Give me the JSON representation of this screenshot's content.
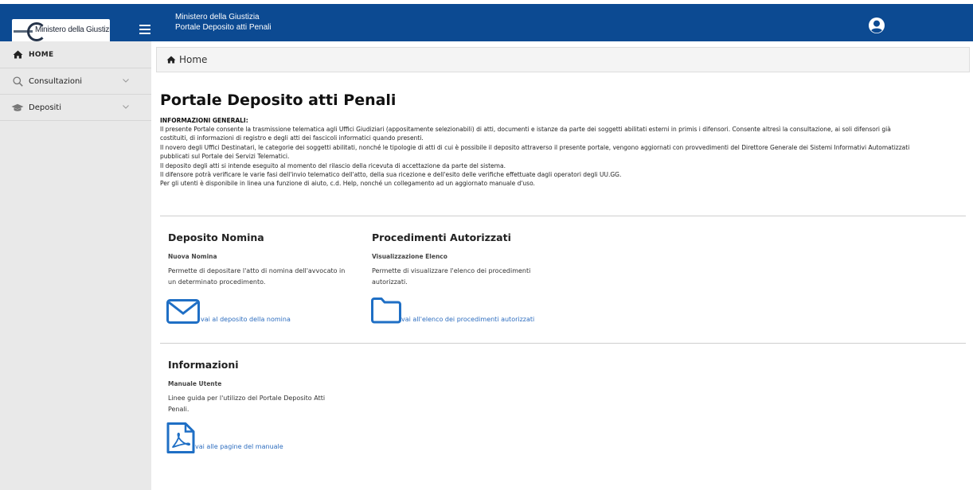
{
  "header": {
    "logo_text": "Ministero della Giustizia",
    "title_line1": "Ministero della Giustizia",
    "title_line2": "Portale Deposito atti Penali",
    "bg_color": "#0c4a92",
    "menu_icon": "hamburger-icon",
    "user_icon": "user-circle-icon"
  },
  "sidebar": {
    "items": [
      {
        "label": "HOME",
        "icon": "home-icon"
      },
      {
        "label": "Consultazioni",
        "icon": "search-icon",
        "chevron": "chevron-down-icon"
      },
      {
        "label": "Depositi",
        "icon": "graduation-cap-icon",
        "chevron": "chevron-down-icon"
      }
    ]
  },
  "breadcrumb": {
    "label": "Home",
    "icon": "home-icon"
  },
  "main": {
    "title": "Portale Deposito atti Penali",
    "info_heading": "INFORMAZIONI GENERALI:",
    "info_paragraphs": [
      "Il presente Portale consente la trasmissione telematica agli Uffici Giudiziari (appositamente selezionabili) di atti, documenti e istanze da parte dei soggetti abilitati esterni in primis i difensori. Consente altresì la consultazione, ai soli difensori già",
      "costituiti, di informazioni di registro e degli atti dei fascicoli informatici quando presenti.",
      "Il novero degli Uffici Destinatari, le categorie dei soggetti abilitati, nonché le tipologie di atti di cui è possibile il deposito attraverso il presente portale, vengono aggiornati con provvedimenti del Direttore Generale dei Sistemi Informativi Automatizzati",
      "pubblicati sul Portale dei Servizi Telematici.",
      "Il deposito degli atti si intende eseguito al momento del rilascio della ricevuta di accettazione da parte del sistema.",
      "Il difensore potrà verificare le varie fasi dell'invio telematico dell'atto, della sua ricezione e dell'esito delle verifiche effettuate dagli operatori degli UU.GG.",
      "Per gli utenti è disponibile in linea una funzione di aiuto, c.d. Help, nonché un collegamento ad un aggiornato manuale d'uso."
    ],
    "cards": {
      "nomina": {
        "title": "Deposito Nomina",
        "subtitle": "Nuova Nomina",
        "desc_line1": "Permette di depositare l'atto di nomina dell'avvocato in",
        "desc_line2": "un determinato procedimento.",
        "link": "vai al deposito della nomina",
        "icon": "envelope-icon"
      },
      "procedimenti": {
        "title": "Procedimenti Autorizzati",
        "subtitle": "Visualizzazione Elenco",
        "desc_line1": "Permette di visualizzare l'elenco dei procedimenti",
        "desc_line2": "autorizzati.",
        "link": "vai all'elenco dei procedimenti autorizzati",
        "icon": "folder-icon"
      },
      "informazioni": {
        "title": "Informazioni",
        "subtitle": "Manuale Utente",
        "desc_line1": "Linee guida per l'utilizzo del Portale Deposito Atti",
        "desc_line2": "Penali.",
        "link": "vai alle pagine del manuale",
        "icon": "pdf-file-icon"
      }
    },
    "accent_color": "#1f6fc5"
  }
}
